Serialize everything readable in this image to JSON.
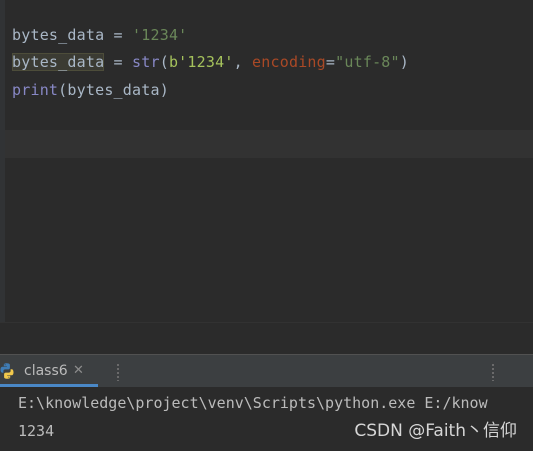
{
  "editor": {
    "lines": [
      {
        "var": "bytes_data",
        "op": " = ",
        "str": "'1234'"
      },
      {
        "var": "bytes_data",
        "op": " = ",
        "builtin": "str",
        "open_paren": "(",
        "bytes_literal": "b'1234'",
        "comma": ", ",
        "kwarg": "encoding",
        "eq": "=",
        "str": "\"utf-8\"",
        "close_paren": ")"
      },
      {
        "builtin": "print",
        "open_paren": "(",
        "var": "bytes_data",
        "close_paren": ")"
      }
    ]
  },
  "run_panel": {
    "tab_label": "class6",
    "close_glyph": "✕",
    "console_lines": [
      "E:\\knowledge\\project\\venv\\Scripts\\python.exe E:/know",
      "1234"
    ]
  },
  "watermark": "CSDN @Faith丶信仰",
  "colors": {
    "editor_bg": "#2b2b2b",
    "panel_bar": "#3c3f41",
    "string": "#6a8759",
    "builtin": "#8888c6",
    "keyword_arg": "#aa4926",
    "default_text": "#a9b7c6",
    "tab_accent": "#4a88c7"
  }
}
